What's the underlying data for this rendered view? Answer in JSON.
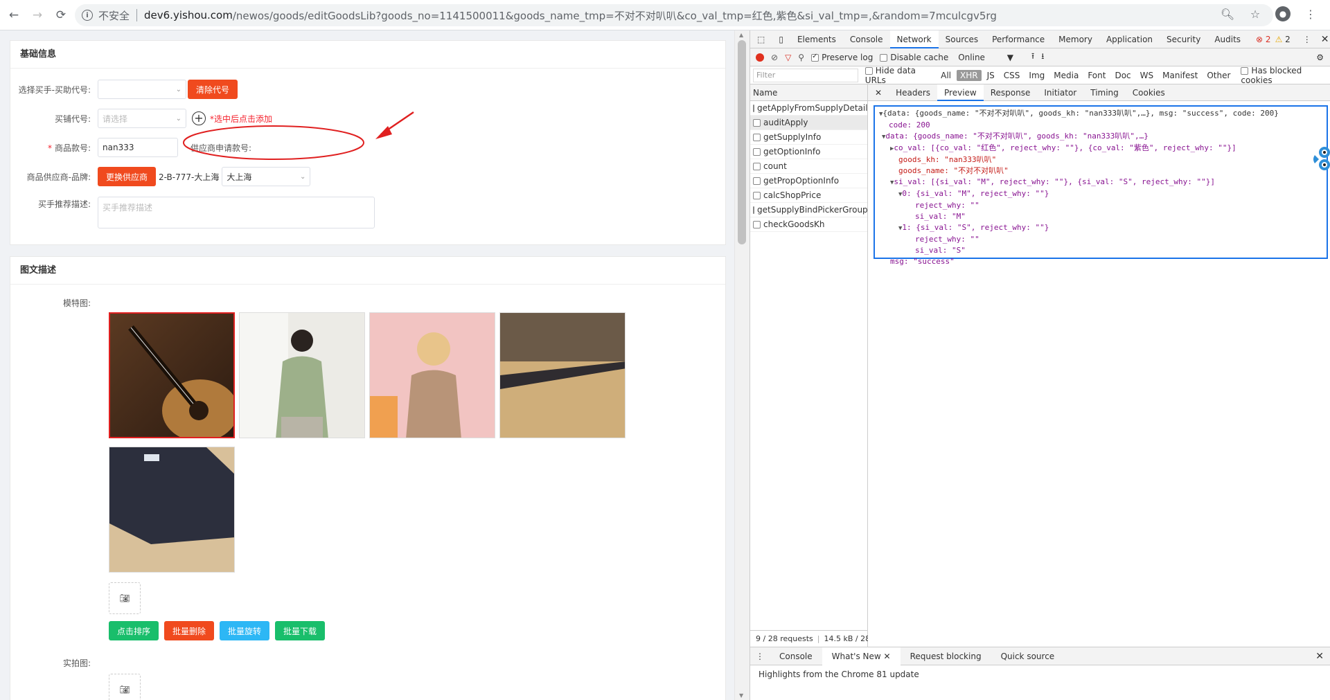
{
  "browser": {
    "url_insecure": "不安全",
    "url_host": "dev6.yishou.com",
    "url_path": "/newos/goods/editGoodsLib?goods_no=1141500011&goods_name_tmp=不对不对叭叭&co_val_tmp=红色,紫色&si_val_tmp=,&random=7mculcgv5rg"
  },
  "basic": {
    "title": "基础信息",
    "buyer_label": "选择买手-买助代号:",
    "clear_code_label": "清除代号",
    "shop_code_label": "买铺代号:",
    "shop_code_placeholder": "请选择",
    "add_hint": "*选中后点击添加",
    "goods_no_label": "商品款号:",
    "goods_no_value": "nan333",
    "supplier_no_label": "供应商申请款号:",
    "supplier_brand_label": "商品供应商-品牌:",
    "change_supplier_label": "更换供应商",
    "supplier_text": "2-B-777-大上海",
    "brand_value": "大上海",
    "recommend_label": "买手推荐描述:",
    "recommend_placeholder": "买手推荐描述"
  },
  "media": {
    "title": "图文描述",
    "model_label": "模特图:",
    "real_label": "实拍图:",
    "btn_sort": "点击排序",
    "btn_delete": "批量删除",
    "btn_rotate": "批量旋转",
    "btn_download": "批量下载",
    "upload_icon": "camera-icon"
  },
  "devtools": {
    "tabs": [
      "Elements",
      "Console",
      "Network",
      "Sources",
      "Performance",
      "Memory",
      "Application",
      "Security",
      "Audits"
    ],
    "errors": "2",
    "warnings": "2",
    "preserve_log": "Preserve log",
    "disable_cache": "Disable cache",
    "throttle": "Online",
    "filter_placeholder": "Filter",
    "hide_data_urls": "Hide data URLs",
    "types": [
      "All",
      "XHR",
      "JS",
      "CSS",
      "Img",
      "Media",
      "Font",
      "Doc",
      "WS",
      "Manifest",
      "Other"
    ],
    "has_blocked": "Has blocked cookies",
    "name_header": "Name",
    "requests": [
      "getApplyFromSupplyDetail",
      "auditApply",
      "getSupplyInfo",
      "getOptionInfo",
      "count",
      "getPropOptionInfo",
      "calcShopPrice",
      "getSupplyBindPickerGroup",
      "checkGoodsKh"
    ],
    "status": "9 / 28 requests",
    "size": "14.5 kB / 28",
    "detail_tabs": [
      "Headers",
      "Preview",
      "Response",
      "Initiator",
      "Timing",
      "Cookies"
    ],
    "preview": [
      "{data: {goods_name: \"不对不对叭叭\", goods_kh: \"nan333叭叭\",…}, msg: \"success\", code: 200}",
      "code: 200",
      "data: {goods_name: \"不对不对叭叭\", goods_kh: \"nan333叭叭\",…}",
      "co_val: [{co_val: \"红色\", reject_why: \"\"}, {co_val: \"紫色\", reject_why: \"\"}]",
      "goods_kh: \"nan333叭叭\"",
      "goods_name: \"不对不对叭叭\"",
      "si_val: [{si_val: \"M\", reject_why: \"\"}, {si_val: \"S\", reject_why: \"\"}]",
      "0: {si_val: \"M\", reject_why: \"\"}",
      "reject_why: \"\"",
      "si_val: \"M\"",
      "1: {si_val: \"S\", reject_why: \"\"}",
      "reject_why: \"\"",
      "si_val: \"S\"",
      "msg: \"success\""
    ],
    "drawer_tabs": [
      "Console",
      "What's New",
      "Request blocking",
      "Quick source"
    ],
    "drawer_body": "Highlights from the Chrome 81 update"
  }
}
